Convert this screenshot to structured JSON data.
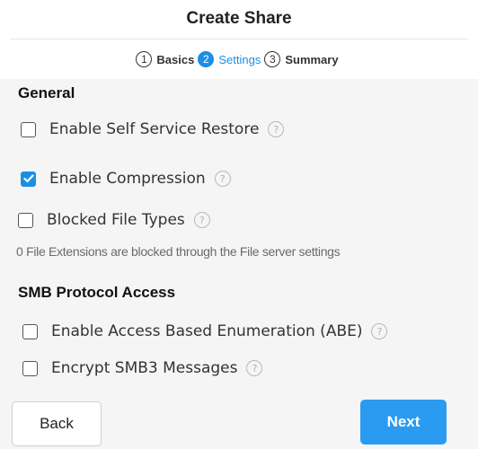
{
  "dialog": {
    "title": "Create Share"
  },
  "steps": [
    {
      "num": "1",
      "label": "Basics",
      "active": false
    },
    {
      "num": "2",
      "label": "Settings",
      "active": true
    },
    {
      "num": "3",
      "label": "Summary",
      "active": false
    }
  ],
  "general": {
    "title": "General",
    "self_service_restore": {
      "label": "Enable Self Service Restore",
      "checked": false
    },
    "compression": {
      "label": "Enable Compression",
      "checked": true
    },
    "blocked_file_types": {
      "label": "Blocked File Types",
      "checked": false
    },
    "blocked_note": "0 File Extensions are blocked through the File server settings"
  },
  "smb": {
    "title": "SMB Protocol Access",
    "abe": {
      "label": "Enable Access Based Enumeration (ABE)",
      "checked": false
    },
    "encrypt": {
      "label": "Encrypt SMB3 Messages",
      "checked": false
    }
  },
  "footer": {
    "back_label": "Back",
    "next_label": "Next"
  },
  "icons": {
    "help": "help-circle-icon",
    "check": "checkmark-icon"
  },
  "colors": {
    "accent": "#1b8fe5",
    "next_button": "#2a9bf0"
  }
}
